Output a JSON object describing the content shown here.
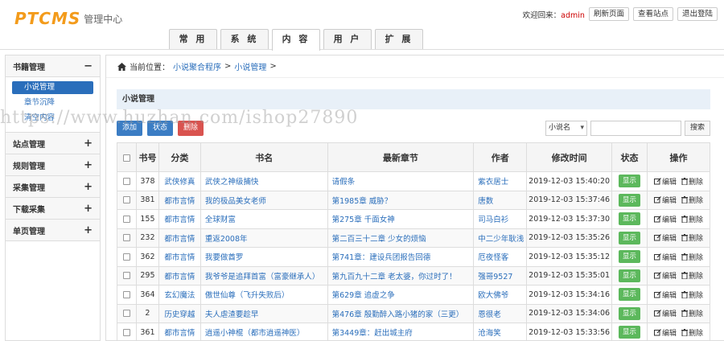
{
  "header": {
    "logo_mark": "PTCMS",
    "logo_sub": "管理中心",
    "welcome_prefix": "欢迎回来：",
    "username": "admin",
    "refresh_label": "刷新页面",
    "view_site_label": "查看站点",
    "logout_label": "退出登陆"
  },
  "tabs": [
    "常 用",
    "系 统",
    "内 容",
    "用 户",
    "扩 展"
  ],
  "sidebar": {
    "group_book": "书籍管理",
    "items": [
      "小说管理",
      "章节沉降",
      "清空内容"
    ],
    "groups": [
      "站点管理",
      "规则管理",
      "采集管理",
      "下载采集",
      "单页管理"
    ]
  },
  "breadcrumb": {
    "prefix": "当前位置：",
    "link1": "小说聚合程序",
    "sep1": ">",
    "link2": "小说管理",
    "sep2": ">"
  },
  "panel_title": "小说管理",
  "actions": {
    "add": "添加",
    "batch": "状态",
    "delete": "删除"
  },
  "search": {
    "select_value": "小说名",
    "button": "搜索"
  },
  "table": {
    "headers": [
      "",
      "书号",
      "分类",
      "书名",
      "最新章节",
      "作者",
      "修改时间",
      "状态",
      "操作"
    ],
    "status_label": "显示",
    "edit_label": "编辑",
    "delete_label": "删除",
    "rows": [
      {
        "id": "378",
        "cat": "武侠修真",
        "name": "武侠之神级捕快",
        "chapter": "请假条",
        "author": "紫衣居士",
        "time": "2019-12-03 15:40:20"
      },
      {
        "id": "381",
        "cat": "都市言情",
        "name": "我的极品美女老师",
        "chapter": "第1985章 威胁？",
        "author": "唐数",
        "time": "2019-12-03 15:37:46"
      },
      {
        "id": "155",
        "cat": "都市言情",
        "name": "全球财富",
        "chapter": "第275章 千面女神",
        "author": "司马白衫",
        "time": "2019-12-03 15:37:30"
      },
      {
        "id": "232",
        "cat": "都市言情",
        "name": "重返2008年",
        "chapter": "第二百三十二章 少女的烦恼",
        "author": "中二少年耿浅",
        "time": "2019-12-03 15:35:26"
      },
      {
        "id": "362",
        "cat": "都市言情",
        "name": "我要做酋罗",
        "chapter": "第741章：建设兵团报告回德",
        "author": "厄夜怪客",
        "time": "2019-12-03 15:35:12"
      },
      {
        "id": "295",
        "cat": "都市言情",
        "name": "我爷爷是追拜首富（富豪继承人）",
        "chapter": "第九百九十二章 老太婆，你过时了！",
        "author": "强哥9527",
        "time": "2019-12-03 15:35:01"
      },
      {
        "id": "364",
        "cat": "玄幻魔法",
        "name": "傲世仙尊（飞升失败后）",
        "chapter": "第629章 追虚之争",
        "author": "欧大佛爷",
        "time": "2019-12-03 15:34:16"
      },
      {
        "id": "2",
        "cat": "历史穿越",
        "name": "夫人虐渣要趁早",
        "chapter": "第476章 殷勤醉入路小猪的家（三更）",
        "author": "恩很老",
        "time": "2019-12-03 15:34:06"
      },
      {
        "id": "361",
        "cat": "都市言情",
        "name": "逍遥小神棍（都市逍遥神医）",
        "chapter": "第3449章：赶出城主府",
        "author": "沧海笑",
        "time": "2019-12-03 15:33:56"
      }
    ]
  },
  "watermark": "https://www.huzhan.com/ishop27890"
}
